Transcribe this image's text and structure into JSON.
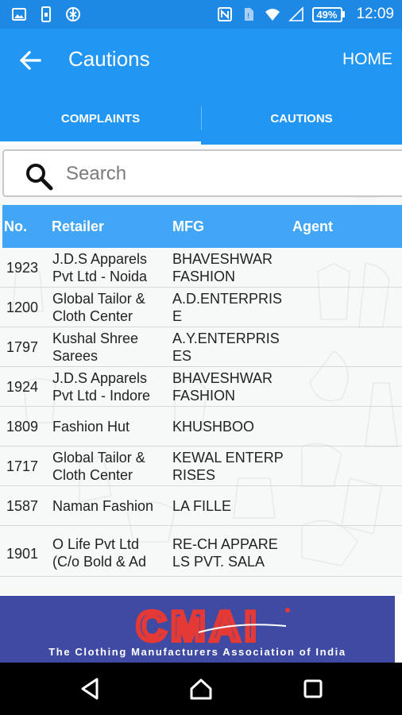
{
  "status_bar": {
    "battery": "49%",
    "time": "12:09",
    "icons": [
      "image-icon",
      "phone-icon",
      "no-sync-icon",
      "nfc-icon",
      "sim-icon",
      "wifi-icon",
      "signal-icon",
      "battery-icon"
    ]
  },
  "app_bar": {
    "title": "Cautions",
    "home_label": "HOME",
    "back_icon": "arrow-left-icon"
  },
  "tabs": [
    {
      "label": "COMPLAINTS",
      "active": true
    },
    {
      "label": "CAUTIONS",
      "active": false
    }
  ],
  "search": {
    "placeholder": "Search",
    "value": ""
  },
  "table": {
    "headers": {
      "no": "No.",
      "retailer": "Retailer",
      "mfg": "MFG",
      "agent": "Agent"
    },
    "rows": [
      {
        "no": "1923",
        "retailer": "J.D.S Apparels Pvt Ltd - Noida",
        "mfg": "BHAVESHWAR FASHION",
        "agent": ""
      },
      {
        "no": "1200",
        "retailer": "Global Tailor & Cloth Center",
        "mfg": "A.D.ENTERPRISE",
        "agent": ""
      },
      {
        "no": "1797",
        "retailer": "Kushal Shree Sarees",
        "mfg": "A.Y.ENTERPRISES",
        "agent": ""
      },
      {
        "no": "1924",
        "retailer": "J.D.S Apparels Pvt Ltd - Indore",
        "mfg": "BHAVESHWAR FASHION",
        "agent": ""
      },
      {
        "no": "1809",
        "retailer": "Fashion Hut",
        "mfg": "KHUSHBOO",
        "agent": ""
      },
      {
        "no": "1717",
        "retailer": "Global Tailor & Cloth Center",
        "mfg": "KEWAL ENTERPRISES",
        "agent": ""
      },
      {
        "no": "1587",
        "retailer": "Naman Fashion",
        "mfg": "LA  FILLE",
        "agent": ""
      },
      {
        "no": "1901",
        "retailer": "O Life Pvt Ltd (C/o Bold & Ad",
        "mfg": "RE-CH APPARELS PVT. SALA",
        "agent": ""
      }
    ]
  },
  "banner": {
    "logo_text": "CMAI",
    "tagline": "The Clothing Manufacturers Association of India"
  },
  "colors": {
    "status_bar": "#1e88e5",
    "primary": "#2196f3",
    "table_header": "#42a5f5",
    "banner_bg": "#3f4aa3",
    "logo_red": "#e53935"
  }
}
